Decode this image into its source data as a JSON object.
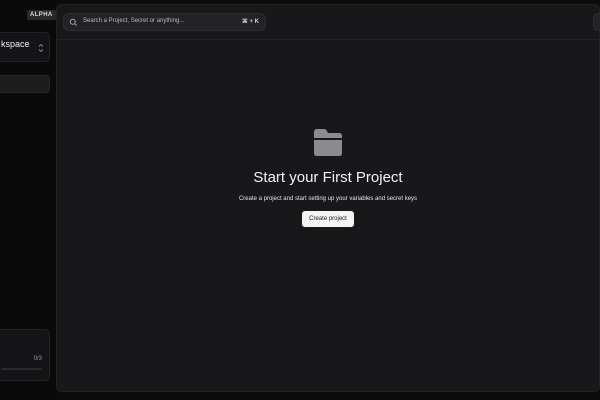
{
  "sidebar": {
    "badge": "ALPHA",
    "workspace": {
      "name": "kspace"
    },
    "usage": {
      "count": "0/3",
      "fraction": 0
    }
  },
  "topbar": {
    "search_placeholder": "Search a Project, Secret or anything...",
    "shortcut": "⌘ + K"
  },
  "empty_state": {
    "title": "Start your First Project",
    "description": "Create a project and start setting up your variables and secret keys",
    "button_label": "Create project"
  },
  "icons": {
    "search": "search-icon",
    "folder": "folder-icon",
    "chevron": "chevron-up-down-icon"
  },
  "colors": {
    "background": "#0b0b0c",
    "panel": "#18181a",
    "button_bg": "#f4f4f5",
    "folder": "#8a8a8f"
  }
}
